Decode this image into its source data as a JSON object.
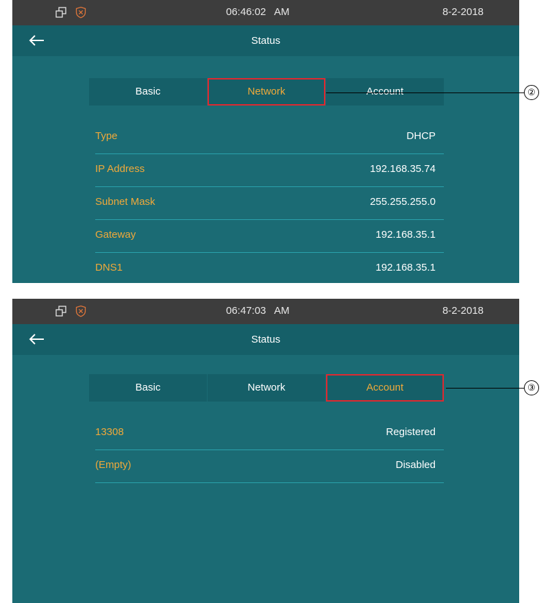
{
  "screens": [
    {
      "status_bar": {
        "left_icons": [
          "windows-icon",
          "shield-icon"
        ],
        "time": "06:46:02   AM",
        "date": "8-2-2018"
      },
      "title": "Status",
      "tabs": [
        {
          "label": "Basic",
          "active": false
        },
        {
          "label": "Network",
          "active": true
        },
        {
          "label": "Account",
          "active": false
        }
      ],
      "rows": [
        {
          "key": "Type",
          "value": "DHCP"
        },
        {
          "key": "IP Address",
          "value": "192.168.35.74"
        },
        {
          "key": "Subnet Mask",
          "value": "255.255.255.0"
        },
        {
          "key": "Gateway",
          "value": "192.168.35.1"
        },
        {
          "key": "DNS1",
          "value": "192.168.35.1"
        }
      ],
      "callout": "②"
    },
    {
      "status_bar": {
        "left_icons": [
          "windows-icon",
          "shield-icon"
        ],
        "time": "06:47:03   AM",
        "date": "8-2-2018"
      },
      "title": "Status",
      "tabs": [
        {
          "label": "Basic",
          "active": false
        },
        {
          "label": "Network",
          "active": false
        },
        {
          "label": "Account",
          "active": true
        }
      ],
      "rows": [
        {
          "key": "13308",
          "value": "Registered"
        },
        {
          "key": "(Empty)",
          "value": "Disabled"
        }
      ],
      "callout": "③"
    }
  ],
  "colors": {
    "background": "#1b6b74",
    "header": "#155f68",
    "status_bar": "#3d3d3d",
    "accent": "#f0a93a",
    "highlight": "#e2282f",
    "divider": "#2aa3ad"
  }
}
